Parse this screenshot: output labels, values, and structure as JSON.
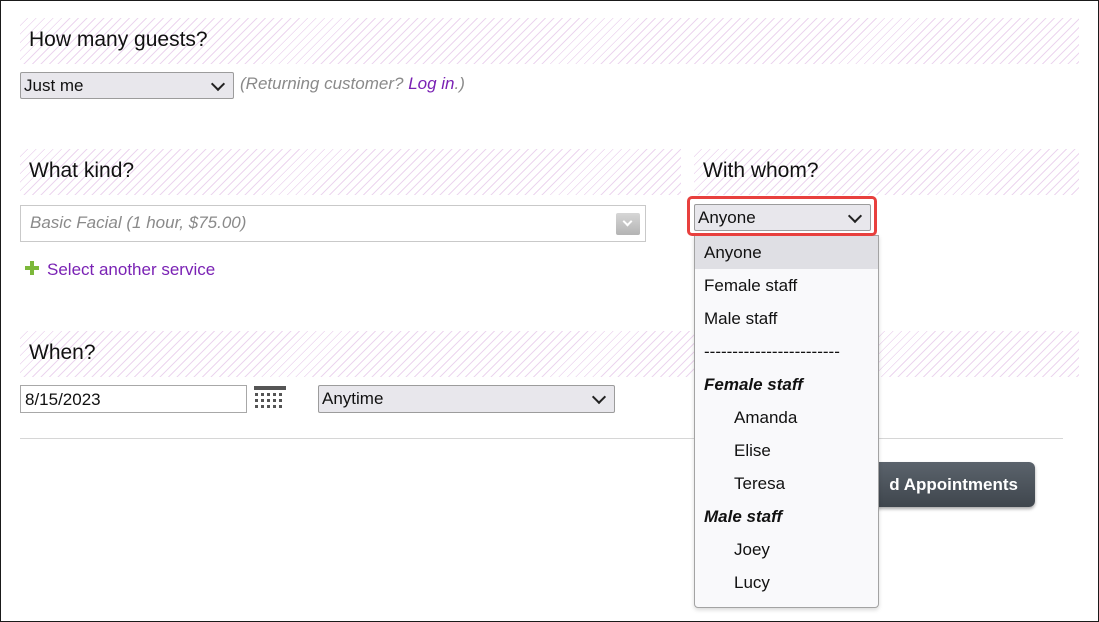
{
  "guests": {
    "heading": "How many guests?",
    "selected": "Just me",
    "returning_prefix": "(Returning customer? ",
    "login_link": "Log in",
    "returning_suffix": ".)"
  },
  "service": {
    "heading": "What kind?",
    "selected": "Basic Facial (1 hour, $75.00)",
    "add_link": "Select another service"
  },
  "staff": {
    "heading": "With whom?",
    "selected": "Anyone",
    "options": [
      {
        "label": "Anyone",
        "type": "option",
        "selected": true
      },
      {
        "label": "Female staff",
        "type": "option"
      },
      {
        "label": "Male staff",
        "type": "option"
      },
      {
        "label": "------------------------",
        "type": "separator"
      },
      {
        "label": "Female staff",
        "type": "group"
      },
      {
        "label": "Amanda",
        "type": "child"
      },
      {
        "label": "Elise",
        "type": "child"
      },
      {
        "label": "Teresa",
        "type": "child"
      },
      {
        "label": "Male staff",
        "type": "group"
      },
      {
        "label": "Joey",
        "type": "child"
      },
      {
        "label": "Lucy",
        "type": "child"
      }
    ]
  },
  "when": {
    "heading": "When?",
    "date": "8/15/2023",
    "time_selected": "Anytime"
  },
  "actions": {
    "find_label": "d Appointments"
  },
  "colors": {
    "link": "#7a22b4",
    "highlight": "#e8403e",
    "stripe": "#ecd6ef",
    "button": "#4a5158",
    "plus": "#7cb83a"
  }
}
